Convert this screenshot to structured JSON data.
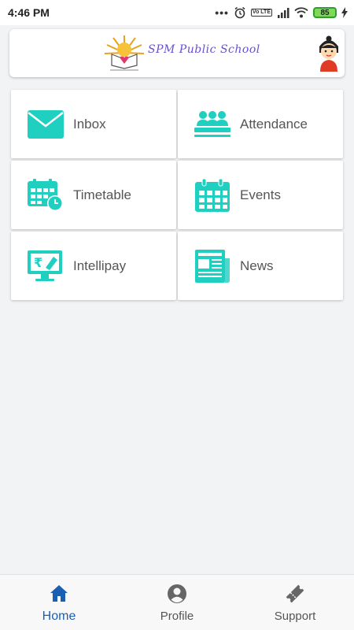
{
  "status_bar": {
    "time": "4:46 PM",
    "battery": "85",
    "volte": "Vo LTE",
    "dots": "•••"
  },
  "header": {
    "school_name": "SPM Public School"
  },
  "menu": [
    {
      "label": "Inbox",
      "icon": "envelope-icon"
    },
    {
      "label": "Attendance",
      "icon": "people-icon"
    },
    {
      "label": "Timetable",
      "icon": "calendar-clock-icon"
    },
    {
      "label": "Events",
      "icon": "calendar-icon"
    },
    {
      "label": "Intellipay",
      "icon": "payment-monitor-icon"
    },
    {
      "label": "News",
      "icon": "newspaper-icon"
    }
  ],
  "bottom_nav": [
    {
      "label": "Home",
      "icon": "home-icon",
      "active": true
    },
    {
      "label": "Profile",
      "icon": "profile-icon",
      "active": false
    },
    {
      "label": "Support",
      "icon": "ticket-icon",
      "active": false
    }
  ],
  "colors": {
    "accent": "#1fcfc0",
    "active_nav": "#1b5fb3",
    "background": "#f2f3f5"
  }
}
